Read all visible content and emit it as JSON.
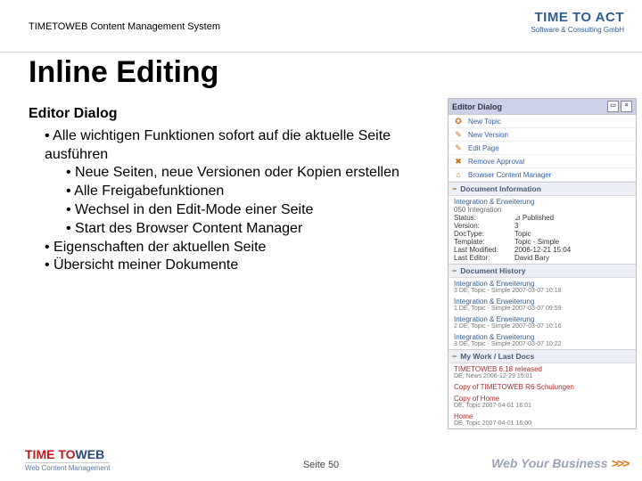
{
  "header": {
    "label": "TIMETOWEB Content Management System"
  },
  "logo_tta": {
    "line1": "TIME TO ACT",
    "line2": "Software & Consulting GmbH"
  },
  "title": "Inline Editing",
  "body": {
    "subtitle": "Editor Dialog",
    "bullets": [
      "Alle wichtigen Funktionen sofort auf die aktuelle Seite ausführen",
      "Eigenschaften der aktuellen Seite",
      "Übersicht meiner Dokumente"
    ],
    "sub_bullets": [
      "Neue Seiten, neue Versionen oder Kopien erstellen",
      "Alle Freigabefunktionen",
      "Wechsel in den Edit-Mode einer Seite",
      "Start des Browser Content Manager"
    ]
  },
  "sidebar": {
    "editor_dialog": {
      "title": "Editor Dialog",
      "items": [
        {
          "icon": "✪",
          "label": "New Topic"
        },
        {
          "icon": "✎",
          "label": "New Version"
        },
        {
          "icon": "✎",
          "label": "Edit Page"
        },
        {
          "icon": "✖",
          "label": "Remove Approval"
        },
        {
          "icon": "⌂",
          "label": "Browser Content Manager"
        }
      ]
    },
    "doc_info": {
      "title": "Document Information",
      "heading": "Integration & Erweiterung",
      "sub": "050 Integration",
      "rows": [
        {
          "k": "Status:",
          "v": "⊿ Published"
        },
        {
          "k": "Version:",
          "v": "3"
        },
        {
          "k": "DocType:",
          "v": "Topic"
        },
        {
          "k": "Template:",
          "v": "Topic - Simple"
        },
        {
          "k": "Last Modified:",
          "v": "2006-12-21 15:04"
        },
        {
          "k": "Last Editor:",
          "v": "David Bary"
        }
      ]
    },
    "history": {
      "title": "Document History",
      "items": [
        {
          "t": "Integration & Erweiterung",
          "m": "3 DE, Topic - Simple 2007-03-07 10:18"
        },
        {
          "t": "Integration & Erweiterung",
          "m": "1 DE, Topic - Simple 2007-03-07 09:59"
        },
        {
          "t": "Integration & Erweiterung",
          "m": "2 DE, Topic - Simple 2007-03-07 10:16"
        },
        {
          "t": "Integration & Erweiterung",
          "m": "3 DE, Topic - Simple 2007-03-07 10:22"
        }
      ]
    },
    "mywork": {
      "title": "My Work / Last Docs",
      "items": [
        {
          "t": "TIMETOWEB 6.18 released",
          "m": "DE, News 2006-12-29 15:01"
        },
        {
          "t": "Copy of TIMETOWEB R6 Schulungen",
          "m": ""
        },
        {
          "t": "Copy of Home",
          "m": "DE, Topic 2007-04-01 16:01"
        },
        {
          "t": "Home",
          "m": "DE, Topic 2007-04-01 16:00"
        }
      ]
    }
  },
  "footer": {
    "ttw_a": "TIME TO",
    "ttw_b": "WEB",
    "ttw_c": "Web Content Management",
    "page": "Seite 50",
    "wyb": "Web Your Business",
    "arrows": ">>>"
  }
}
